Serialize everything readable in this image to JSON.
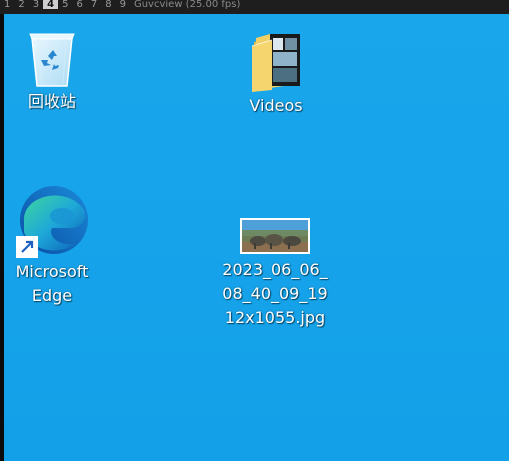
{
  "topbar": {
    "tabs": [
      "1",
      "2",
      "3",
      "4",
      "5",
      "6",
      "7",
      "8",
      "9"
    ],
    "active_tab": "4",
    "app_title": "Guvcview (25.00 fps)"
  },
  "desktop": {
    "icons": [
      {
        "label": "回收站",
        "icon": "recycle-bin-icon"
      },
      {
        "label": "Videos",
        "icon": "folder-icon"
      },
      {
        "label": "Microsoft\nEdge",
        "icon": "edge-icon"
      },
      {
        "label": "2023_06_06_\n08_40_09_19\n12x1055.jpg",
        "icon": "image-thumbnail"
      }
    ]
  },
  "colors": {
    "desktop_background": "#16a3ea",
    "topbar_background": "#1e1e1e"
  }
}
